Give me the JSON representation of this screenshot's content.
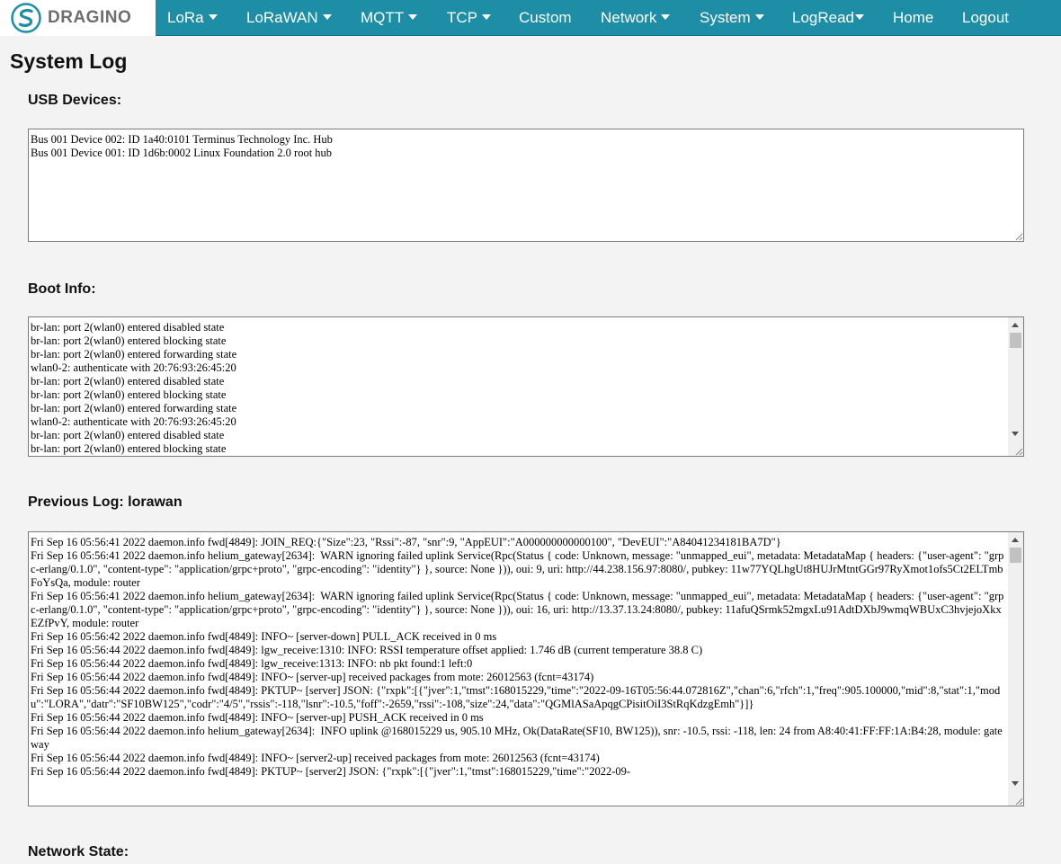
{
  "nav": {
    "brand": "DRAGINO",
    "items": [
      {
        "label": "LoRa",
        "dropdown": true
      },
      {
        "label": "LoRaWAN",
        "dropdown": true
      },
      {
        "label": "MQTT",
        "dropdown": true
      },
      {
        "label": "TCP",
        "dropdown": true
      },
      {
        "label": "Custom",
        "dropdown": false
      },
      {
        "label": "Network",
        "dropdown": true
      },
      {
        "label": "System",
        "dropdown": true
      },
      {
        "label": "LogRead",
        "dropdown": true
      },
      {
        "label": "Home",
        "dropdown": false
      },
      {
        "label": "Logout",
        "dropdown": false
      }
    ],
    "dropdown_icon": "caret-down-icon",
    "bar_color": "#1e8ea6"
  },
  "page": {
    "title": "System Log"
  },
  "sections": {
    "usb": {
      "label": "USB Devices:",
      "text": "Bus 001 Device 002: ID 1a40:0101 Terminus Technology Inc. Hub\nBus 001 Device 001: ID 1d6b:0002 Linux Foundation 2.0 root hub"
    },
    "boot": {
      "label": "Boot Info:",
      "text": "br-lan: port 2(wlan0) entered disabled state\nbr-lan: port 2(wlan0) entered blocking state\nbr-lan: port 2(wlan0) entered forwarding state\nwlan0-2: authenticate with 20:76:93:26:45:20\nbr-lan: port 2(wlan0) entered disabled state\nbr-lan: port 2(wlan0) entered blocking state\nbr-lan: port 2(wlan0) entered forwarding state\nwlan0-2: authenticate with 20:76:93:26:45:20\nbr-lan: port 2(wlan0) entered disabled state\nbr-lan: port 2(wlan0) entered blocking state"
    },
    "previous": {
      "label": "Previous Log: lorawan",
      "text": "Fri Sep 16 05:56:41 2022 daemon.info fwd[4849]: JOIN_REQ:{\"Size\":23, \"Rssi\":-87, \"snr\":9, \"AppEUI\":\"A000000000000100\", \"DevEUI\":\"A84041234181BA7D\"}\nFri Sep 16 05:56:41 2022 daemon.info helium_gateway[2634]:  WARN ignoring failed uplink Service(Rpc(Status { code: Unknown, message: \"unmapped_eui\", metadata: MetadataMap { headers: {\"user-agent\": \"grpc-erlang/0.1.0\", \"content-type\": \"application/grpc+proto\", \"grpc-encoding\": \"identity\"} }, source: None })), oui: 9, uri: http://44.238.156.97:8080/, pubkey: 11w77YQLhgUt8HUJrMtntGGr97RyXmot1ofs5Ct2ELTmbFoYsQa, module: router\nFri Sep 16 05:56:41 2022 daemon.info helium_gateway[2634]:  WARN ignoring failed uplink Service(Rpc(Status { code: Unknown, message: \"unmapped_eui\", metadata: MetadataMap { headers: {\"user-agent\": \"grpc-erlang/0.1.0\", \"content-type\": \"application/grpc+proto\", \"grpc-encoding\": \"identity\"} }, source: None })), oui: 16, uri: http://13.37.13.24:8080/, pubkey: 11afuQSrmk52mgxLu91AdtDXbJ9wmqWBUxC3hvjejoXkxEZfPvY, module: router\nFri Sep 16 05:56:42 2022 daemon.info fwd[4849]: INFO~ [server-down] PULL_ACK received in 0 ms\nFri Sep 16 05:56:44 2022 daemon.info fwd[4849]: lgw_receive:1310: INFO: RSSI temperature offset applied: 1.746 dB (current temperature 38.8 C)\nFri Sep 16 05:56:44 2022 daemon.info fwd[4849]: lgw_receive:1313: INFO: nb pkt found:1 left:0\nFri Sep 16 05:56:44 2022 daemon.info fwd[4849]: INFO~ [server-up] received packages from mote: 26012563 (fcnt=43174)\nFri Sep 16 05:56:44 2022 daemon.info fwd[4849]: PKTUP~ [server] JSON: {\"rxpk\":[{\"jver\":1,\"tmst\":168015229,\"time\":\"2022-09-16T05:56:44.072816Z\",\"chan\":6,\"rfch\":1,\"freq\":905.100000,\"mid\":8,\"stat\":1,\"modu\":\"LORA\",\"datr\":\"SF10BW125\",\"codr\":\"4/5\",\"rssis\":-118,\"lsnr\":-10.5,\"foff\":-2659,\"rssi\":-108,\"size\":24,\"data\":\"QGMlASaApqgCPisitOiI3StRqKdzgEmh\"}]}\nFri Sep 16 05:56:44 2022 daemon.info fwd[4849]: INFO~ [server-up] PUSH_ACK received in 0 ms\nFri Sep 16 05:56:44 2022 daemon.info helium_gateway[2634]:  INFO uplink @168015229 us, 905.10 MHz, Ok(DataRate(SF10, BW125)), snr: -10.5, rssi: -118, len: 24 from A8:40:41:FF:FF:1A:B4:28, module: gateway\nFri Sep 16 05:56:44 2022 daemon.info fwd[4849]: INFO~ [server2-up] received packages from mote: 26012563 (fcnt=43174)\nFri Sep 16 05:56:44 2022 daemon.info fwd[4849]: PKTUP~ [server2] JSON: {\"rxpk\":[{\"jver\":1,\"tmst\":168015229,\"time\":\"2022-09-"
    },
    "network": {
      "label": "Network State:"
    }
  }
}
